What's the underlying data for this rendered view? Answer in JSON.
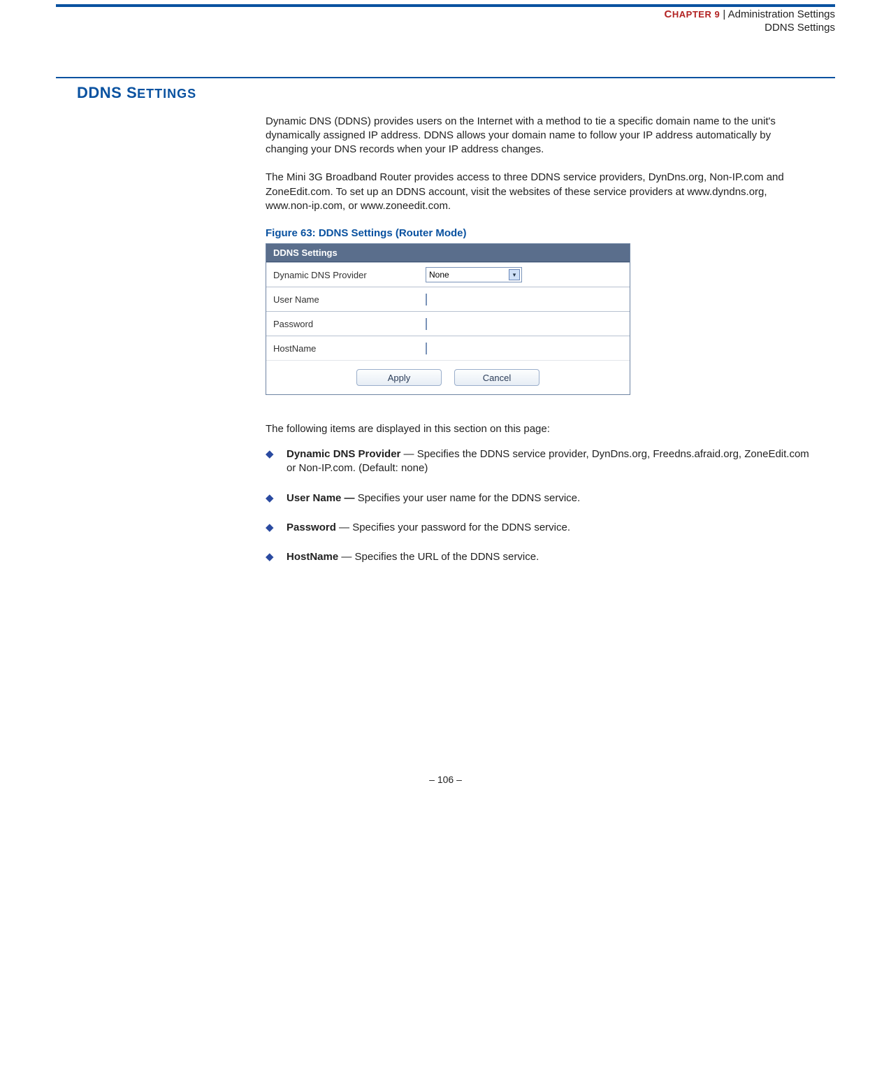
{
  "header": {
    "chapter_label_caps": "C",
    "chapter_label_rest": "HAPTER 9",
    "separator": "  |  ",
    "breadcrumb_parent": "Administration Settings",
    "breadcrumb_current": "DDNS Settings"
  },
  "section_title": {
    "big": "DDNS S",
    "small": "ETTINGS"
  },
  "paragraphs": {
    "p1": "Dynamic DNS (DDNS) provides users on the Internet with a method to tie a specific domain name to the unit's dynamically assigned IP address. DDNS allows your domain name to follow your IP address automatically by changing your DNS records when your IP address changes.",
    "p2": "The Mini 3G Broadband Router provides access to three DDNS service providers, DynDns.org, Non-IP.com and ZoneEdit.com. To set up an DDNS account, visit the websites of these service providers at www.dyndns.org, www.non-ip.com, or www.zoneedit.com."
  },
  "figure": {
    "caption": "Figure 63:  DDNS Settings (Router Mode)",
    "panel_title": "DDNS Settings",
    "rows": {
      "provider_label": "Dynamic DNS Provider",
      "provider_value": "None",
      "username_label": "User Name",
      "password_label": "Password",
      "hostname_label": "HostName"
    },
    "buttons": {
      "apply": "Apply",
      "cancel": "Cancel"
    }
  },
  "items_intro": "The following items are displayed in this section on this page:",
  "bullets": [
    {
      "bold": "Dynamic DNS Provider",
      "rest": " — Specifies the DDNS service provider, DynDns.org, Freedns.afraid.org, ZoneEdit.com or Non-IP.com. (Default: none)"
    },
    {
      "bold": "User Name —",
      "rest": " Specifies your user name for the DDNS service."
    },
    {
      "bold": "Password",
      "rest": " — Specifies your password for the DDNS service."
    },
    {
      "bold": "HostName",
      "rest": " — Specifies the URL of the DDNS service."
    }
  ],
  "footer": "–  106  –"
}
